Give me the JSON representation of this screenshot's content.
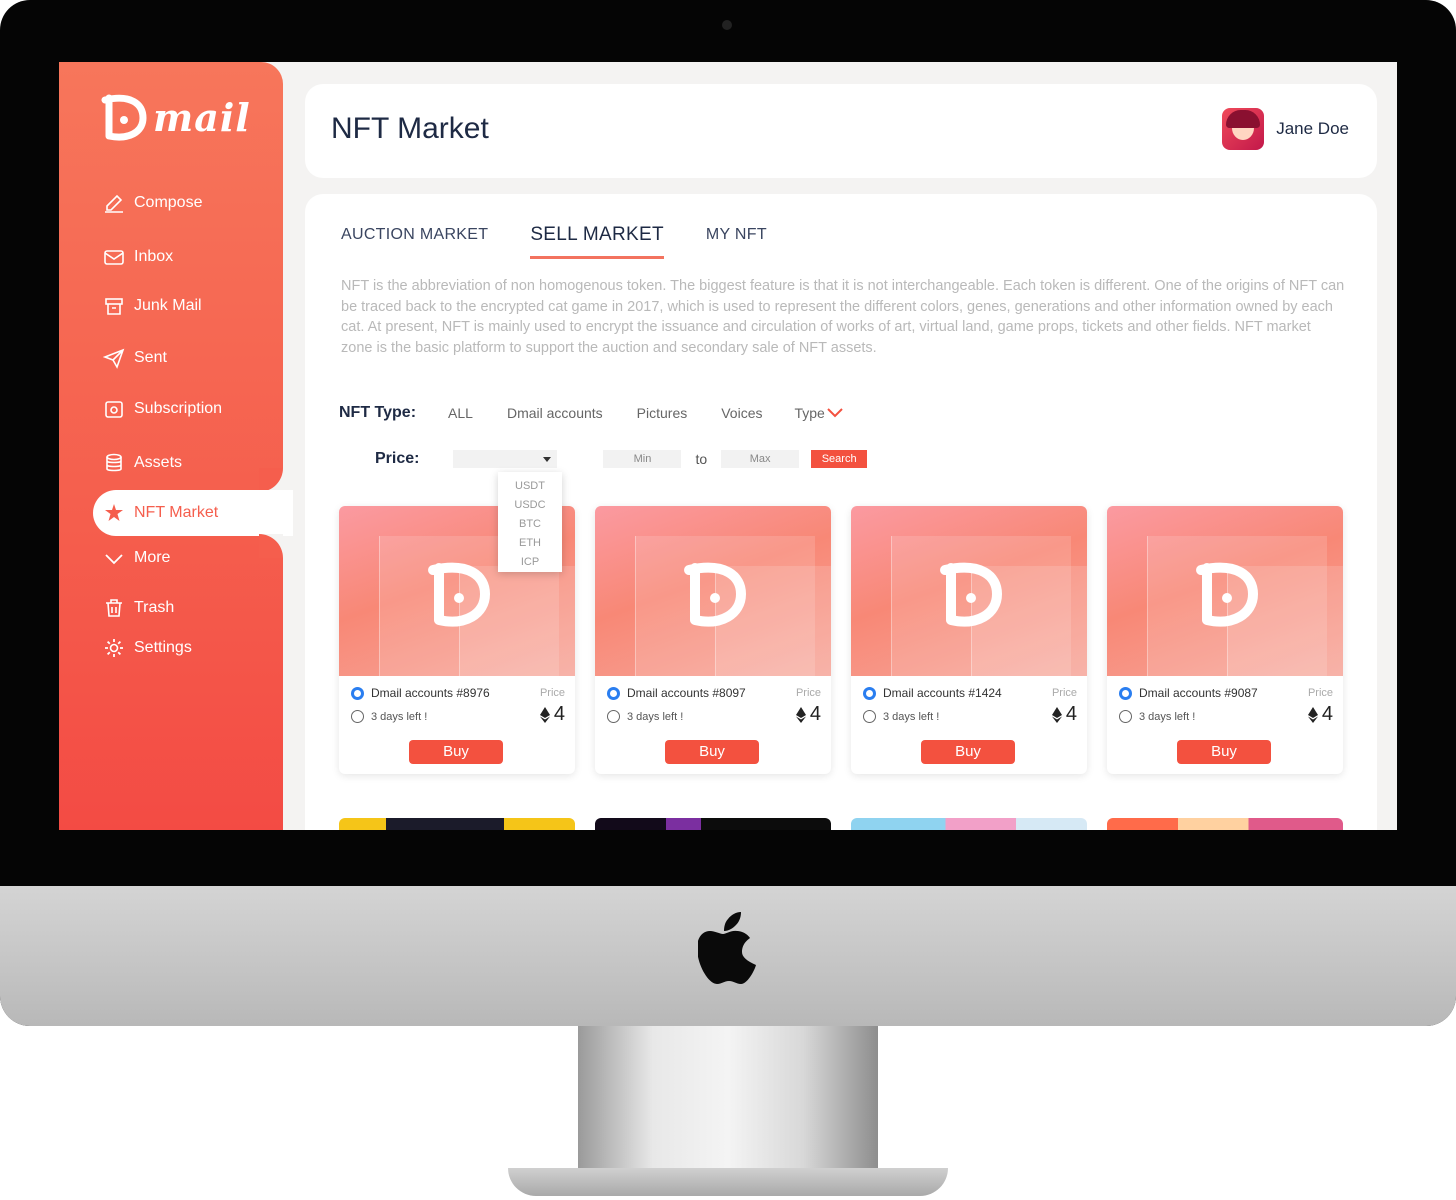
{
  "app": {
    "brand_name": "mail"
  },
  "sidebar": {
    "items": [
      {
        "label": "Compose",
        "icon": "compose-icon"
      },
      {
        "label": "Inbox",
        "icon": "inbox-icon"
      },
      {
        "label": "Junk Mail",
        "icon": "junk-icon"
      },
      {
        "label": "Sent",
        "icon": "sent-icon"
      },
      {
        "label": "Subscription",
        "icon": "subscription-icon"
      },
      {
        "label": "Assets",
        "icon": "assets-icon"
      },
      {
        "label": "NFT Market",
        "icon": "nft-market-icon",
        "active": true
      },
      {
        "label": "More",
        "icon": "chevron-down-icon"
      },
      {
        "label": "Trash",
        "icon": "trash-icon"
      },
      {
        "label": "Settings",
        "icon": "gear-icon"
      }
    ]
  },
  "header": {
    "title": "NFT Market",
    "user_name": "Jane Doe"
  },
  "tabs": [
    {
      "label": "AUCTION MARKET"
    },
    {
      "label": "SELL MARKET",
      "active": true
    },
    {
      "label": "MY NFT"
    }
  ],
  "description": "NFT is the abbreviation of non homogenous token. The biggest feature is that it is not interchangeable. Each token is different. One of the origins of NFT can be traced back to the encrypted cat game in 2017, which is used to represent the different colors, genes, generations and other information owned by each cat. At present, NFT is mainly used to encrypt the issuance and circulation of works of art, virtual land, game props, tickets and other fields. NFT market zone is the basic platform to support the auction and secondary sale of NFT assets.",
  "filters": {
    "type_label": "NFT Type:",
    "type_options": [
      "ALL",
      "Dmail accounts",
      "Pictures",
      "Voices"
    ],
    "type_dropdown": "Type",
    "price_label": "Price:",
    "min_placeholder": "Min",
    "to_label": "to",
    "max_placeholder": "Max",
    "search_label": "Search",
    "currency_options": [
      "USDT",
      "USDC",
      "BTC",
      "ETH",
      "ICP"
    ]
  },
  "cards": [
    {
      "name": "Dmail accounts #8976",
      "price_label": "Price",
      "time_left": "3 days left !",
      "price": "4",
      "buy_label": "Buy"
    },
    {
      "name": "Dmail accounts #8097",
      "price_label": "Price",
      "time_left": "3 days left !",
      "price": "4",
      "buy_label": "Buy"
    },
    {
      "name": "Dmail accounts #1424",
      "price_label": "Price",
      "time_left": "3 days left !",
      "price": "4",
      "buy_label": "Buy"
    },
    {
      "name": "Dmail accounts #9087",
      "price_label": "Price",
      "time_left": "3 days left !",
      "price": "4",
      "buy_label": "Buy"
    }
  ],
  "colors": {
    "accent": "#f55e4d",
    "title_text": "#1e2a44",
    "button": "#f3513f"
  }
}
